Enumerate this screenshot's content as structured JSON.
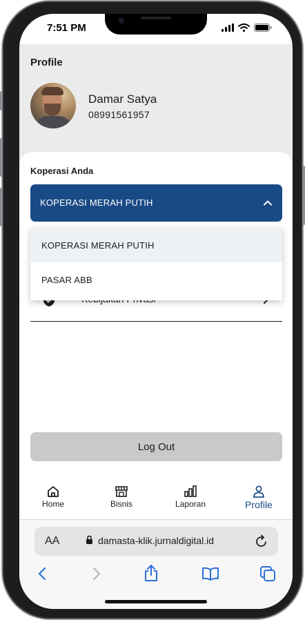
{
  "status_bar": {
    "time": "7:51 PM"
  },
  "profile": {
    "title": "Profile",
    "name": "Damar Satya",
    "phone": "08991561957"
  },
  "cooperative": {
    "section_label": "Koperasi Anda",
    "selected": "KOPERASI MERAH PUTIH",
    "options": [
      "KOPERASI MERAH PUTIH",
      "PASAR ABB"
    ]
  },
  "menu": {
    "privacy_label": "Kebijakan Privasi"
  },
  "logout_label": "Log Out",
  "tabs": [
    {
      "label": "Home",
      "icon": "home-icon"
    },
    {
      "label": "Bisnis",
      "icon": "store-icon"
    },
    {
      "label": "Laporan",
      "icon": "bar-chart-icon"
    },
    {
      "label": "Profile",
      "icon": "person-icon",
      "active": true
    }
  ],
  "browser": {
    "text_size_label": "AA",
    "url": "damasta-klik.jurnaldigital.id"
  },
  "colors": {
    "primary": "#1a4a85",
    "logout_bg": "#c9c9c9",
    "page_bg": "#ebebeb"
  }
}
